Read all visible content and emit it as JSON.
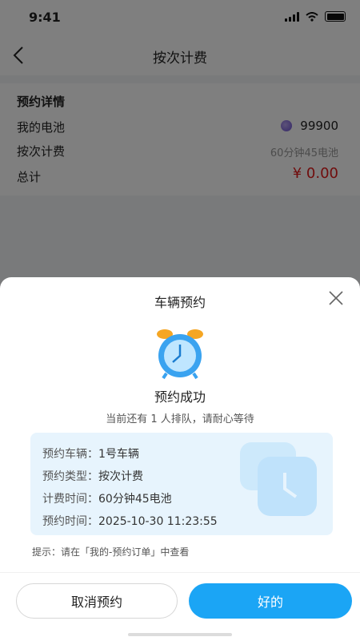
{
  "status_bar": {
    "time": "9:41"
  },
  "nav": {
    "title": "按次计费"
  },
  "reservation_details": {
    "heading": "预约详情",
    "battery_label": "我的电池",
    "battery_value": "99900",
    "billing_label": "按次计费",
    "billing_value": "60分钟45电池",
    "total_label": "总计",
    "total_value": "¥ 0.00"
  },
  "sheet": {
    "title": "车辆预约",
    "success_text": "预约成功",
    "queue_text": "当前还有 1 人排队，请耐心等待",
    "info": [
      {
        "key": "预约车辆：",
        "value": "1号车辆"
      },
      {
        "key": "预约类型：",
        "value": "按次计费"
      },
      {
        "key": "计费时间：",
        "value": "60分钟45电池"
      },
      {
        "key": "预约时间：",
        "value": "2025-10-30 11:23:55"
      }
    ],
    "hint": "提示：请在「我的-预约订单」中查看",
    "cancel_label": "取消预约",
    "ok_label": "好的"
  },
  "colors": {
    "accent": "#1ba5f5",
    "price": "#e01b1b",
    "info_bg": "#e7f4fd"
  }
}
